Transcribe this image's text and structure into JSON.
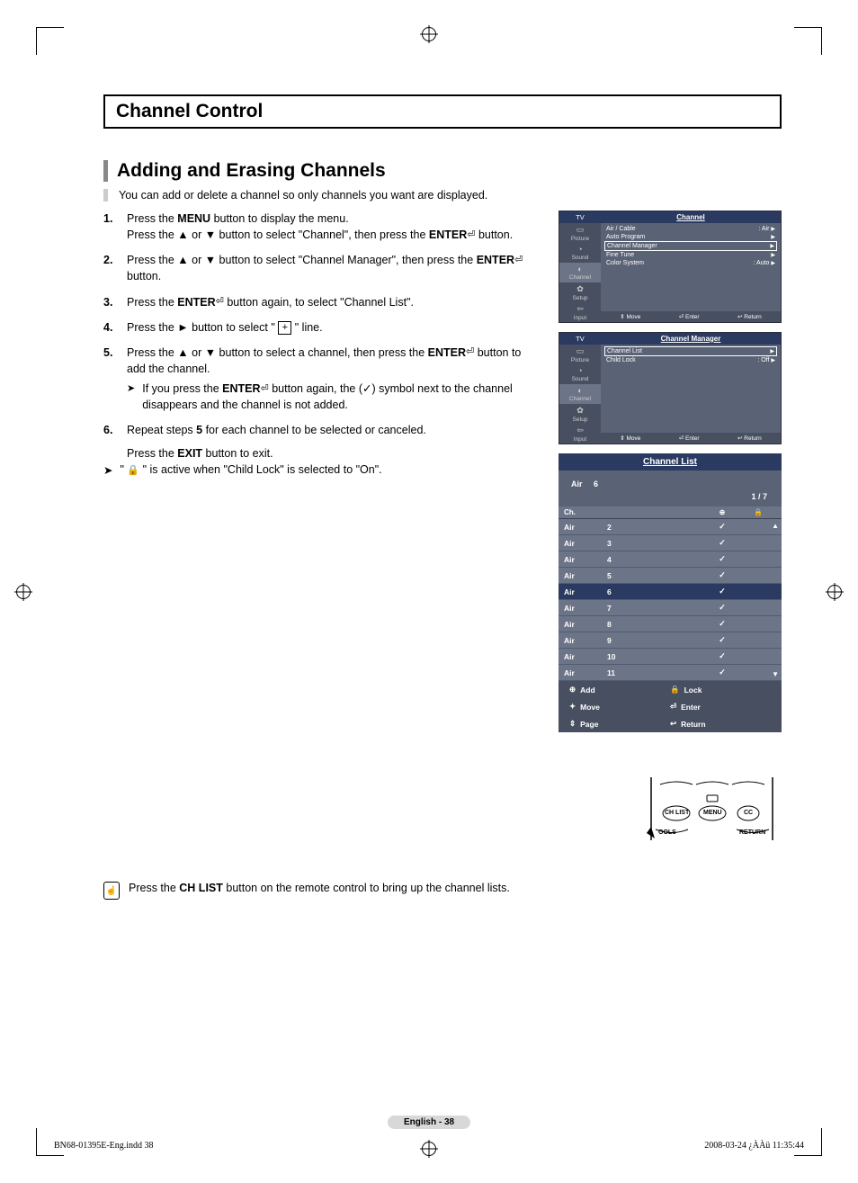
{
  "section_title": "Channel Control",
  "subsection_title": "Adding and Erasing Channels",
  "intro": "You can add or delete a channel so only channels you want are displayed.",
  "steps": [
    {
      "num": "1.",
      "lines": [
        "Press the <b>MENU</b> button to display the menu.",
        "Press the ▲ or ▼ button to select \"Channel\", then press the <b>ENTER</b><span class='enter-icon'>⏎</span> button."
      ]
    },
    {
      "num": "2.",
      "lines": [
        "Press the ▲ or ▼ button to select \"Channel Manager\", then press the <b>ENTER</b><span class='enter-icon'>⏎</span> button."
      ]
    },
    {
      "num": "3.",
      "lines": [
        "Press the <b>ENTER</b><span class='enter-icon'>⏎</span> button again, to select \"Channel List\"."
      ]
    },
    {
      "num": "4.",
      "lines": [
        "Press the ► button to select \" <span class='plus-box'>+</span> \" line."
      ]
    },
    {
      "num": "5.",
      "lines": [
        "Press the ▲ or ▼ button to select a channel, then press the <b>ENTER</b><span class='enter-icon'>⏎</span> button to add the channel."
      ],
      "sub": "If you press the <b>ENTER</b><span class='enter-icon'>⏎</span> button again, the (✓) symbol next to the channel disappears and the channel is not added."
    },
    {
      "num": "6.",
      "lines": [
        "Repeat steps <b>5</b> for each channel to be selected or canceled."
      ]
    }
  ],
  "exit_line": "Press the <b>EXIT</b> button to exit.",
  "lock_note": "\" <span class='lock-sm'>🔒</span> \" is active when \"Child Lock\" is selected to \"On\".",
  "osd1": {
    "tv": "TV",
    "title": "Channel",
    "tabs": [
      "Picture",
      "Sound",
      "Channel",
      "Setup",
      "Input"
    ],
    "items": [
      {
        "l": "Air / Cable",
        "r": ": Air"
      },
      {
        "l": "Auto Program",
        "r": ""
      },
      {
        "l": "Channel Manager",
        "r": "",
        "sel": true
      },
      {
        "l": "Fine Tune",
        "r": ""
      },
      {
        "l": "Color System",
        "r": ": Auto"
      }
    ],
    "foot": [
      "⇕ Move",
      "⏎ Enter",
      "↩ Return"
    ]
  },
  "osd2": {
    "tv": "TV",
    "title": "Channel Manager",
    "tabs": [
      "Picture",
      "Sound",
      "Channel",
      "Setup",
      "Input"
    ],
    "items": [
      {
        "l": "Channel List",
        "r": "",
        "sel": true
      },
      {
        "l": "Child Lock",
        "r": ": Off"
      }
    ],
    "foot": [
      "⇕ Move",
      "⏎ Enter",
      "↩ Return"
    ]
  },
  "chlist": {
    "title": "Channel List",
    "current": "Air     6",
    "page": "1 / 7",
    "col_ch": "Ch.",
    "rows": [
      {
        "t": "Air",
        "n": "2",
        "c": true
      },
      {
        "t": "Air",
        "n": "3",
        "c": true
      },
      {
        "t": "Air",
        "n": "4",
        "c": true
      },
      {
        "t": "Air",
        "n": "5",
        "c": true
      },
      {
        "t": "Air",
        "n": "6",
        "c": true,
        "sel": true
      },
      {
        "t": "Air",
        "n": "7",
        "c": true
      },
      {
        "t": "Air",
        "n": "8",
        "c": true
      },
      {
        "t": "Air",
        "n": "9",
        "c": true
      },
      {
        "t": "Air",
        "n": "10",
        "c": true
      },
      {
        "t": "Air",
        "n": "11",
        "c": true
      }
    ],
    "foot": [
      [
        {
          "i": "⊕",
          "t": "Add"
        },
        {
          "i": "🔒",
          "t": "Lock"
        }
      ],
      [
        {
          "i": "✦",
          "t": "Move"
        },
        {
          "i": "⏎",
          "t": "Enter"
        }
      ],
      [
        {
          "i": "⇕",
          "t": "Page"
        },
        {
          "i": "↩",
          "t": "Return"
        }
      ]
    ]
  },
  "tip": "Press the <b>CH LIST</b> button on the remote control to bring up the channel lists.",
  "remote": {
    "b1": "CH LIST",
    "b2": "MENU",
    "b3": "CC",
    "l1": "OOLS",
    "l2": "RETURN"
  },
  "page_num": "English - 38",
  "pfoot_l": "BN68-01395E-Eng.indd   38",
  "pfoot_r": "2008-03-24   ¿ÀÀü 11:35:44"
}
